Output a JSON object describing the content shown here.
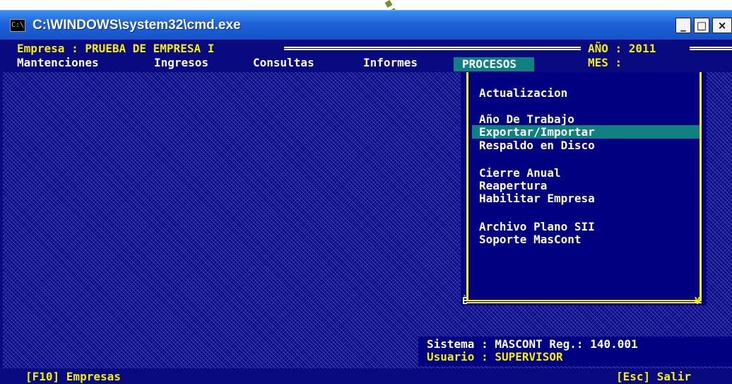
{
  "window": {
    "title": "C:\\WINDOWS\\system32\\cmd.exe",
    "icon_text": "C:\\",
    "buttons": [
      "_",
      "□",
      "×"
    ]
  },
  "header": {
    "empresa_label": "Empresa : PRUEBA DE EMPRESA I",
    "ano_label": "AÑO : 2011",
    "mes_label": "MES :"
  },
  "menu": {
    "items": [
      "Mantenciones",
      "Ingresos",
      "Consultas",
      "Informes",
      "PROCESOS"
    ],
    "active": "PROCESOS"
  },
  "dropdown": {
    "items": [
      "Actualizacion",
      "Año De Trabajo",
      "Exportar/Importar",
      "Respaldo en Disco",
      "Cierre Anual",
      "Reapertura",
      "Habilitar Empresa",
      "Archivo Plano SII",
      "Soporte MasCont"
    ],
    "selected": "Exportar/Importar",
    "corner_left": "È",
    "corner_right": "¥"
  },
  "status": {
    "sistema": "Sistema : MASCONT Reg.: 140.001",
    "usuario": "Usuario : SUPERVISOR"
  },
  "footer": {
    "left": "[F10] Empresas",
    "right": "[Esc] Salir"
  },
  "colors": {
    "console_bg": "#0a0a80",
    "highlight": "#118080",
    "yellow": "#f4f000",
    "arrow": "#6b7f2a"
  }
}
